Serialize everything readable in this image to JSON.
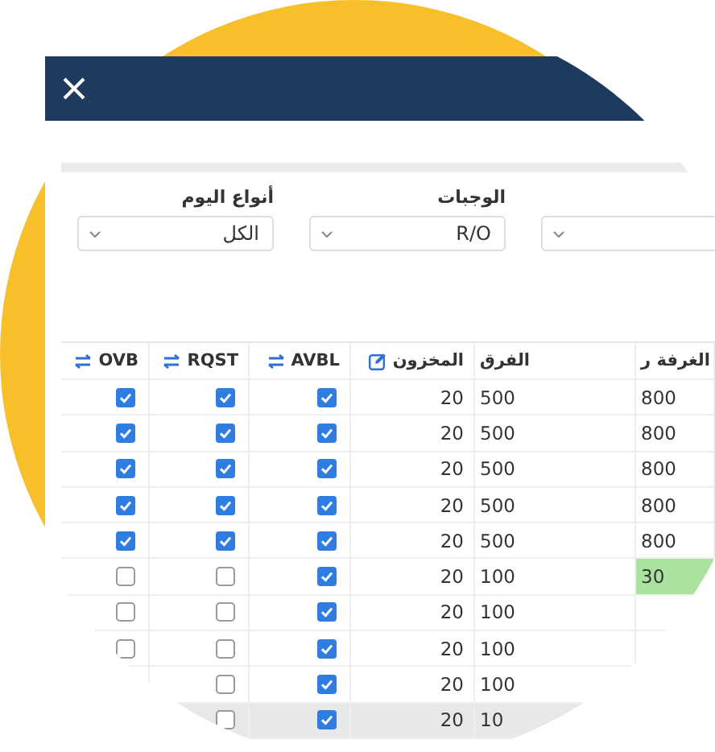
{
  "filter_labels": [
    {
      "text": "الوجبات"
    },
    {
      "text": "أنواع اليوم"
    }
  ],
  "filters": [
    {
      "kind": "select",
      "value": "الكل"
    },
    {
      "kind": "select",
      "value": "R/O"
    },
    {
      "kind": "select"
    }
  ],
  "table": {
    "columns": [
      {
        "label": "OVB",
        "kind": "check"
      },
      {
        "label": "RQST",
        "kind": "check"
      },
      {
        "label": "AVBL",
        "kind": "check"
      },
      {
        "label": "المخزون",
        "kind": "number"
      },
      {
        "label": "الفرق",
        "kind": "text"
      },
      {
        "label": "الغرفة ر",
        "kind": "text"
      }
    ],
    "rows": [
      {
        "selected": false,
        "highlight": false,
        "cells": [
          true,
          true,
          true,
          "20",
          "500",
          "800"
        ]
      },
      {
        "selected": false,
        "highlight": false,
        "cells": [
          true,
          true,
          true,
          "20",
          "500",
          "800"
        ]
      },
      {
        "selected": false,
        "highlight": false,
        "cells": [
          true,
          true,
          true,
          "20",
          "500",
          "800"
        ]
      },
      {
        "selected": false,
        "highlight": false,
        "cells": [
          true,
          true,
          true,
          "20",
          "500",
          "800"
        ]
      },
      {
        "selected": false,
        "highlight": false,
        "cells": [
          true,
          true,
          true,
          "20",
          "500",
          "800"
        ]
      },
      {
        "selected": false,
        "highlight": true,
        "cells": [
          false,
          false,
          true,
          "20",
          "100",
          "30"
        ]
      },
      {
        "selected": false,
        "cells": [
          false,
          false,
          true,
          "20",
          "100",
          null
        ]
      },
      {
        "selected": false,
        "cells": [
          false,
          false,
          true,
          "20",
          "100",
          null
        ]
      },
      {
        "selected": false,
        "cells": [
          null,
          false,
          true,
          "20",
          "100",
          null
        ]
      },
      {
        "selected": true,
        "cells": [
          null,
          false,
          true,
          "20",
          "10",
          null
        ]
      }
    ]
  }
}
